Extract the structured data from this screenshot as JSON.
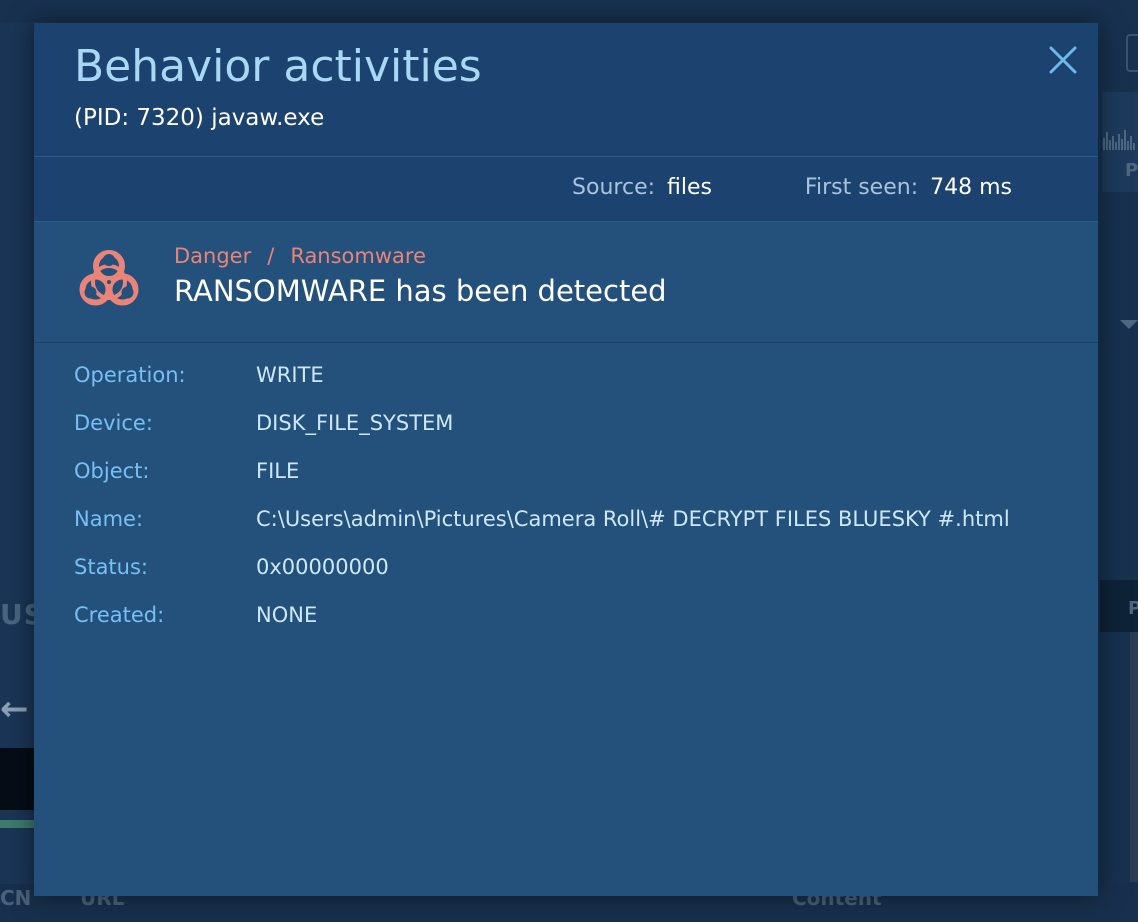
{
  "background": {
    "left_heading_fragment": "USE",
    "right_letter_top": "P",
    "right_letter_bottom": "P",
    "bottom_left_fragment": "CN",
    "bottom_column_url": "URL",
    "bottom_column_content": "Content"
  },
  "modal": {
    "title": "Behavior activities",
    "subtitle": "(PID: 7320) javaw.exe",
    "close_icon": "close-icon",
    "meta": {
      "source_label": "Source:",
      "source_value": "files",
      "first_seen_label": "First seen:",
      "first_seen_value": "748 ms"
    },
    "alert": {
      "icon": "biohazard-icon",
      "level": "Danger",
      "separator": "/",
      "category": "Ransomware",
      "message": "RANSOMWARE has been detected",
      "color": "#ea8478"
    },
    "details": [
      {
        "label": "Operation:",
        "value": "WRITE"
      },
      {
        "label": "Device:",
        "value": "DISK_FILE_SYSTEM"
      },
      {
        "label": "Object:",
        "value": "FILE"
      },
      {
        "label": "Name:",
        "value": "C:\\Users\\admin\\Pictures\\Camera Roll\\# DECRYPT FILES BLUESKY #.html"
      },
      {
        "label": "Status:",
        "value": "0x00000000"
      },
      {
        "label": "Created:",
        "value": "NONE"
      }
    ]
  }
}
